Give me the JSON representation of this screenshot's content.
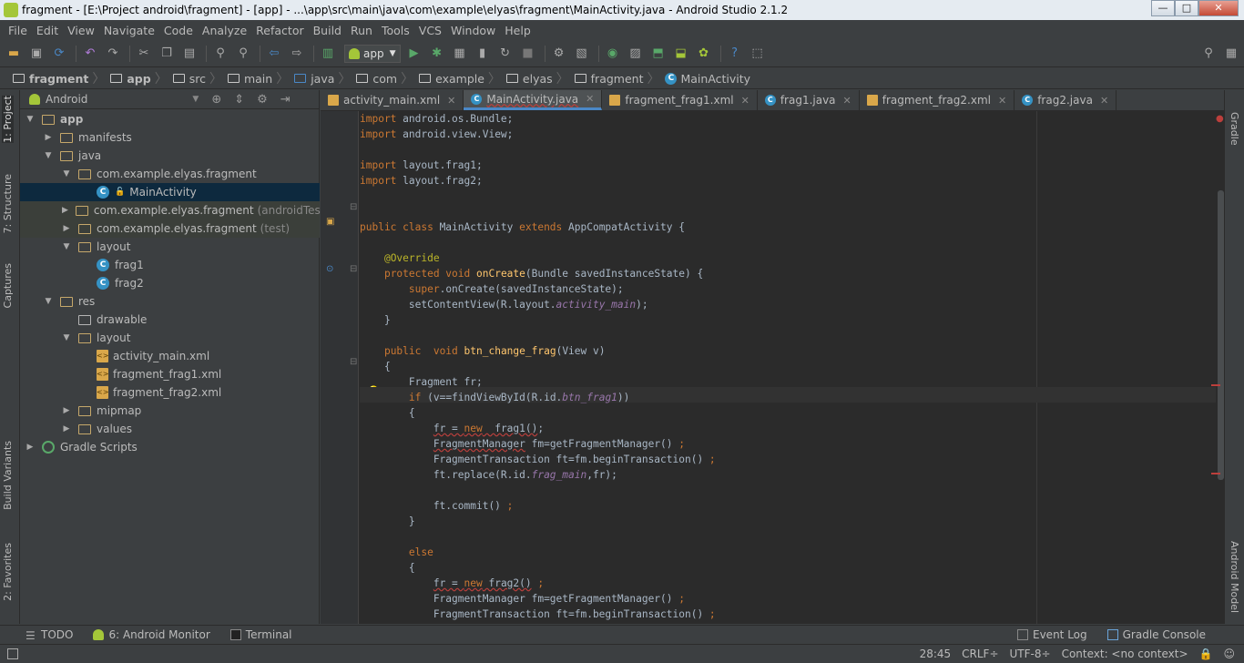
{
  "window": {
    "title": "fragment - [E:\\Project android\\fragment] - [app] - ...\\app\\src\\main\\java\\com\\example\\elyas\\fragment\\MainActivity.java - Android Studio 2.1.2",
    "btn_min": "—",
    "btn_max": "□",
    "btn_close": "✕"
  },
  "menu": [
    "File",
    "Edit",
    "View",
    "Navigate",
    "Code",
    "Analyze",
    "Refactor",
    "Build",
    "Run",
    "Tools",
    "VCS",
    "Window",
    "Help"
  ],
  "toolbar": {
    "run_config": "app",
    "icons": [
      "open-icon",
      "save-icon",
      "sync-icon",
      "undo-icon",
      "redo-icon",
      "cut-icon",
      "copy-icon",
      "paste-icon",
      "find-icon",
      "replace-icon",
      "back-icon",
      "forward-icon",
      "make-icon",
      "run-icon",
      "debug-icon",
      "coverage-icon",
      "attach-icon",
      "rerun-icon",
      "stop-icon",
      "structure-icon",
      "sdk-icon",
      "avd-icon",
      "device-monitor-icon",
      "gradle-sync-icon",
      "android-icon",
      "help-icon",
      "gradle-icon"
    ]
  },
  "breadcrumb": [
    "fragment",
    "app",
    "src",
    "main",
    "java",
    "com",
    "example",
    "elyas",
    "fragment",
    "MainActivity"
  ],
  "left_tabs": [
    "1: Project",
    "7: Structure",
    "Captures",
    "Build Variants",
    "2: Favorites"
  ],
  "right_tabs": [
    "Gradle",
    "Android Model"
  ],
  "project": {
    "view": "Android",
    "tree": [
      {
        "label": "app",
        "suffix": "",
        "depth": 0,
        "arrow": "▼",
        "icon": "folder"
      },
      {
        "label": "manifests",
        "suffix": "",
        "depth": 1,
        "arrow": "▶",
        "icon": "folder"
      },
      {
        "label": "java",
        "suffix": "",
        "depth": 1,
        "arrow": "▼",
        "icon": "folder"
      },
      {
        "label": "com.example.elyas.fragment",
        "suffix": "",
        "depth": 2,
        "arrow": "▼",
        "icon": "folder"
      },
      {
        "label": "MainActivity",
        "suffix": "",
        "depth": 3,
        "arrow": "",
        "icon": "class",
        "selected": true
      },
      {
        "label": "com.example.elyas.fragment",
        "suffix": "(androidTest)",
        "depth": 2,
        "arrow": "▶",
        "icon": "folder",
        "test": true
      },
      {
        "label": "com.example.elyas.fragment",
        "suffix": "(test)",
        "depth": 2,
        "arrow": "▶",
        "icon": "folder",
        "test": true
      },
      {
        "label": "layout",
        "suffix": "",
        "depth": 2,
        "arrow": "▼",
        "icon": "folder"
      },
      {
        "label": "frag1",
        "suffix": "",
        "depth": 3,
        "arrow": "",
        "icon": "class"
      },
      {
        "label": "frag2",
        "suffix": "",
        "depth": 3,
        "arrow": "",
        "icon": "class"
      },
      {
        "label": "res",
        "suffix": "",
        "depth": 1,
        "arrow": "▼",
        "icon": "folder"
      },
      {
        "label": "drawable",
        "suffix": "",
        "depth": 2,
        "arrow": "",
        "icon": "folder"
      },
      {
        "label": "layout",
        "suffix": "",
        "depth": 2,
        "arrow": "▼",
        "icon": "folder"
      },
      {
        "label": "activity_main.xml",
        "suffix": "",
        "depth": 3,
        "arrow": "",
        "icon": "xml"
      },
      {
        "label": "fragment_frag1.xml",
        "suffix": "",
        "depth": 3,
        "arrow": "",
        "icon": "xml"
      },
      {
        "label": "fragment_frag2.xml",
        "suffix": "",
        "depth": 3,
        "arrow": "",
        "icon": "xml"
      },
      {
        "label": "mipmap",
        "suffix": "",
        "depth": 2,
        "arrow": "▶",
        "icon": "folder"
      },
      {
        "label": "values",
        "suffix": "",
        "depth": 2,
        "arrow": "▶",
        "icon": "folder"
      },
      {
        "label": "Gradle Scripts",
        "suffix": "",
        "depth": 0,
        "arrow": "▶",
        "icon": "gradle"
      }
    ]
  },
  "tabs": [
    {
      "label": "activity_main.xml",
      "icon": "xml"
    },
    {
      "label": "MainActivity.java",
      "icon": "class",
      "active": true
    },
    {
      "label": "fragment_frag1.xml",
      "icon": "xml"
    },
    {
      "label": "frag1.java",
      "icon": "class"
    },
    {
      "label": "fragment_frag2.xml",
      "icon": "xml"
    },
    {
      "label": "frag2.java",
      "icon": "class"
    }
  ],
  "code": [
    "<span class=\"kw\">import</span> android.os.Bundle;",
    "<span class=\"kw\">import</span> android.view.View;",
    "",
    "<span class=\"kw\">import</span> layout.frag1;",
    "<span class=\"kw\">import</span> layout.frag2;",
    "",
    "",
    "<span class=\"kw\">public class</span> MainActivity <span class=\"kw\">extends</span> AppCompatActivity {",
    "",
    "    <span class=\"an\">@Override</span>",
    "    <span class=\"kw\">protected void</span> <span class=\"fn\">onCreate</span>(Bundle savedInstanceState) {",
    "        <span class=\"kw\">super</span>.onCreate(savedInstanceState);",
    "        setContentView(R.layout.<span class=\"it\">activity_main</span>);",
    "    }",
    "",
    "    <span class=\"kw\">public  void</span> <span class=\"fn\">btn_change_frag</span>(View v)",
    "    {",
    "        Fragment fr;",
    "        <span class=\"kw\">if</span> (v==findViewById(R.id.<span class=\"it\">btn_frag1</span>))",
    "        {",
    "            <span class=\"und\">fr = </span><span class=\"kw und\">new</span><span class=\"und\">  frag1()</span>;",
    "            <span class=\"und\">FragmentManager</span> fm=getFragmentManager() <span class=\"kw\">;</span>",
    "            FragmentTransaction ft=fm.beginTransaction() <span class=\"kw\">;</span>",
    "            ft.replace(R.id.<span class=\"it\">frag_main</span>,fr);",
    "",
    "            ft.commit() <span class=\"kw\">;</span>",
    "        }",
    "",
    "        <span class=\"kw\">else</span>",
    "        {",
    "            <span class=\"und\">fr = </span><span class=\"kw und\">new</span><span class=\"und\"> frag2()</span> <span class=\"kw\">;</span>",
    "            FragmentManager fm=getFragmentManager() <span class=\"kw\">;</span>",
    "            FragmentTransaction ft=fm.beginTransaction() <span class=\"kw\">;</span>"
  ],
  "bottom_tabs": {
    "todo": "TODO",
    "monitor": "6: Android Monitor",
    "terminal": "Terminal",
    "event_log": "Event Log",
    "gradle_console": "Gradle Console"
  },
  "status": {
    "position": "28:45",
    "line_sep": "CRLF÷",
    "encoding": "UTF-8÷",
    "context": "Context: <no context>"
  },
  "colors": {
    "accent": "#4a88c7",
    "error": "#bc3f3c",
    "android": "#a4c639"
  }
}
